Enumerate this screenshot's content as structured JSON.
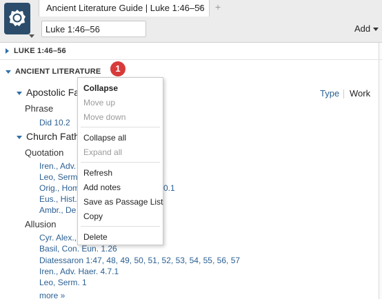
{
  "tab": {
    "title": "Ancient Literature Guide | Luke 1:46–56",
    "close": "×",
    "add": "+"
  },
  "toolbar": {
    "reference_value": "Luke 1:46–56",
    "add_label": "Add"
  },
  "sections": {
    "luke": "LUKE 1:46–56",
    "ancient": "ANCIENT LITERATURE"
  },
  "badge": "1",
  "view_toggle": {
    "type": "Type",
    "work": "Work"
  },
  "apostolic": {
    "title": "Apostolic Fat",
    "phrase_label": "Phrase",
    "phrase_links": [
      "Did 10.2"
    ]
  },
  "church": {
    "title": "Church Fathe",
    "quotation_label": "Quotation",
    "quotation_links": [
      "Iren., Adv.",
      "Leo, Serm.",
      "Orig., Hom",
      "Eus., Hist.",
      "Ambr., De"
    ],
    "quotation_suffix": "0.1",
    "allusion_label": "Allusion",
    "allusion_links": [
      "Cyr. Alex.,",
      "Basil, Con. Eun. 1.26"
    ],
    "diatessaron_prefix": "Diatessaron 1:47,",
    "diatessaron_numbers": [
      "48,",
      "49,",
      "50,",
      "51,",
      "52,",
      "53,",
      "54,",
      "55,",
      "56,",
      "57"
    ],
    "allusion_links_2": [
      "Iren., Adv. Haer. 4.7.1",
      "Leo, Serm. 1"
    ],
    "more": "more »"
  },
  "context_menu": {
    "collapse": "Collapse",
    "move_up": "Move up",
    "move_down": "Move down",
    "collapse_all": "Collapse all",
    "expand_all": "Expand all",
    "refresh": "Refresh",
    "add_notes": "Add notes",
    "save_passage": "Save as Passage List",
    "copy": "Copy",
    "delete": "Delete"
  }
}
